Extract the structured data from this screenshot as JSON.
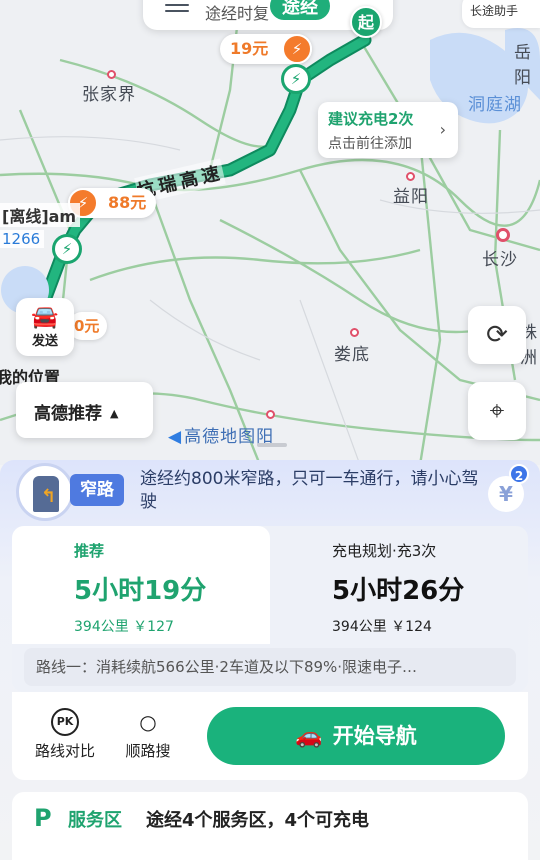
{
  "map": {
    "pass_text": "途经时复",
    "via_badge": "途经",
    "helper_chip": "长途助手",
    "start_label": "起",
    "prices": {
      "p1": "19元",
      "p2": "88元",
      "p3": "0元"
    },
    "suggest": {
      "title": "建议充电2次",
      "subtitle": "点击前往添加"
    },
    "highway_label": "杭瑞高速",
    "cities": [
      "张家界",
      "益阳",
      "长沙",
      "娄底",
      "洞庭湖",
      "岳阳",
      "株洲"
    ],
    "offline_label": "[离线]am",
    "offline_num": "1266",
    "send_label": "发送",
    "my_location": "我的位置",
    "preference": "高德推荐",
    "watermark": "高德地图阳"
  },
  "panel": {
    "narrow_badge": "窄路",
    "narrow_text": "途经约800米窄路，只可一车通行，请小心驾驶",
    "yen_count": "2",
    "plans": [
      {
        "tag": "推荐",
        "time": "5小时19分",
        "meta": "394公里  ￥127"
      },
      {
        "tag": "充电规划·充3次",
        "time": "5小时26分",
        "meta": "394公里  ￥124"
      }
    ],
    "route_line": "路线一：消耗续航566公里·2车道及以下89%·限速电子…",
    "actions": {
      "compare": "路线对比",
      "search": "顺路搜",
      "start_nav": "开始导航"
    },
    "service": {
      "title": "服务区",
      "text": "途经4个服务区，4个可充电"
    }
  }
}
